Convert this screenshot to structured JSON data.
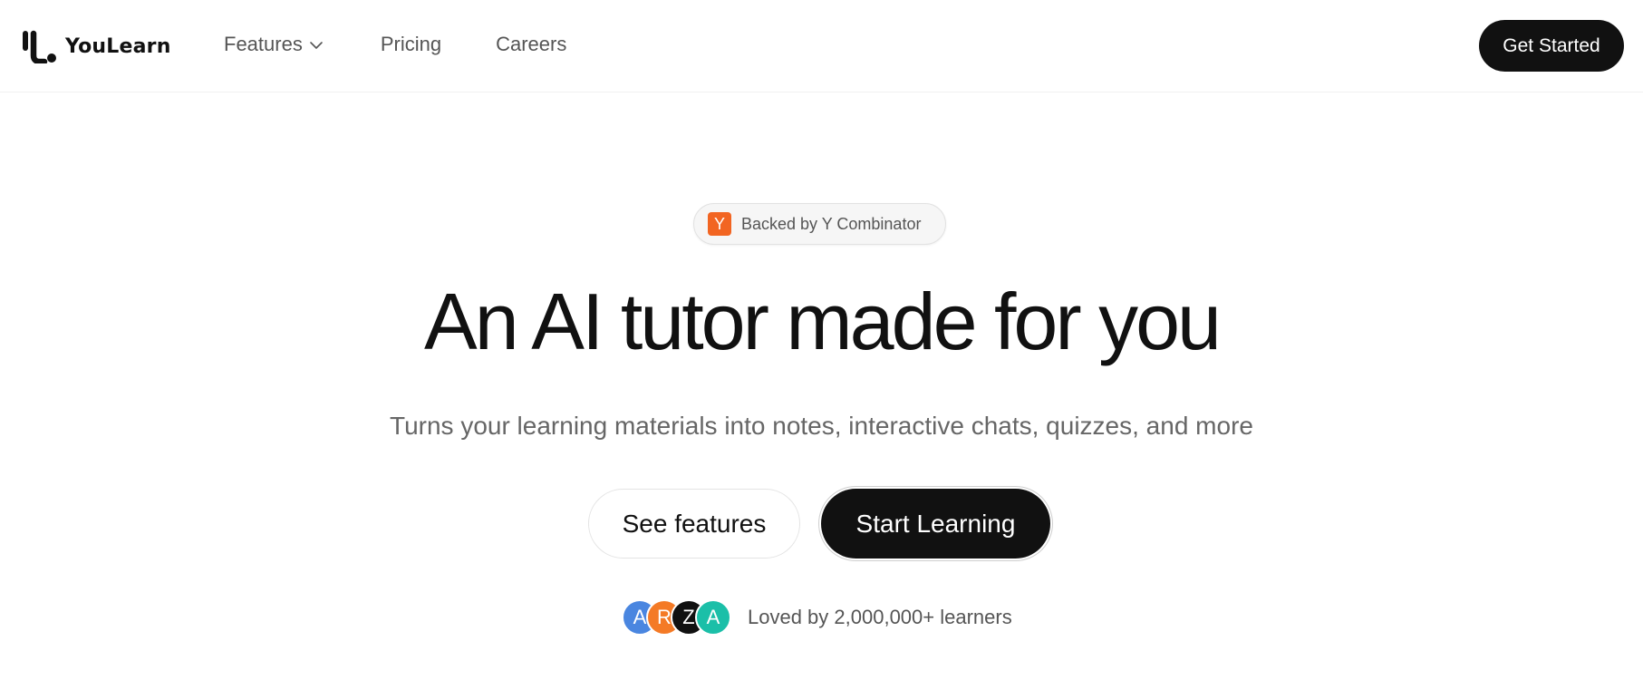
{
  "header": {
    "logo_text": "YouLearn",
    "nav": {
      "features": "Features",
      "pricing": "Pricing",
      "careers": "Careers"
    },
    "cta_label": "Get Started"
  },
  "hero": {
    "badge": {
      "logo_letter": "Y",
      "text": "Backed by Y Combinator"
    },
    "title": "An AI tutor made for you",
    "subtitle": "Turns your learning materials into notes, interactive chats, quizzes, and more",
    "secondary_button": "See features",
    "primary_button": "Start Learning",
    "social_proof": {
      "avatars": [
        {
          "letter": "A",
          "color": "#4a86e0"
        },
        {
          "letter": "R",
          "color": "#f47a26"
        },
        {
          "letter": "Z",
          "color": "#111111"
        },
        {
          "letter": "A",
          "color": "#1bbfa8"
        }
      ],
      "text": "Loved by 2,000,000+ learners"
    }
  },
  "colors": {
    "brand_dark": "#111111",
    "yc_orange": "#f26522",
    "muted_text": "#555555"
  },
  "icons": {
    "logo": "youlearn-logo-icon",
    "features_dropdown": "chevron-down-icon"
  }
}
